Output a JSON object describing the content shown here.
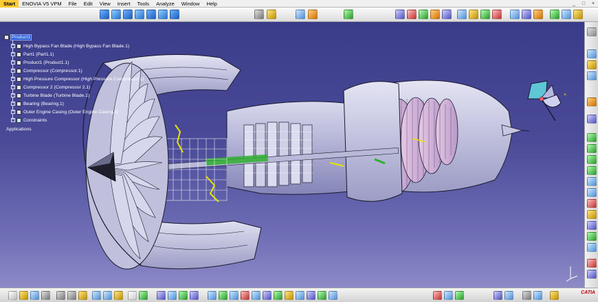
{
  "menu": {
    "items": [
      "Start",
      "ENOVIA V5 VPM",
      "File",
      "Edit",
      "View",
      "Insert",
      "Tools",
      "Analyze",
      "Window",
      "Help"
    ]
  },
  "window_controls": [
    "_",
    "□",
    "×"
  ],
  "tree": {
    "root": "Product1",
    "items": [
      "High Bypass Fan Blade (High Bypass Fan Blade.1)",
      "Part1 (Part1.1)",
      "Product1 (Product1.1)",
      "Compressor (Compressor.1)",
      "High Pressure Compressor (High Pressure Compressor.1)",
      "Compressor 2 (Compressor 2.1)",
      "Turbine Blade (Turbine Blade.1)",
      "Bearing (Bearing.1)",
      "Outer Engine Casing (Outer Engine Casing.1)",
      "Constraints"
    ],
    "footer": "Applications"
  },
  "brand": "CATIA",
  "colors": {
    "background_top": "#3a3c8a",
    "background_bottom": "#8c8ac6",
    "part_fill": "#c9c9e6",
    "part_stroke": "#1a1a2e",
    "selection": "#2c5fd8",
    "highlight_yellow": "#e6e600",
    "highlight_green": "#2fae2f"
  },
  "icons": {
    "top_toolbar": [
      "product-icon",
      "part-icon",
      "assembly-icon",
      "catalog-icon",
      "constraint-icon",
      "measure-icon",
      "analysis-icon",
      "render-icon",
      "light-icon",
      "camera-icon",
      "section-icon",
      "clash-icon",
      "annotation-icon",
      "move-icon",
      "snap-icon"
    ],
    "right_toolbar": [
      "select-icon",
      "component-icon",
      "product-icon",
      "part-icon",
      "replace-icon",
      "graph-icon",
      "renumber-icon",
      "reorder-icon",
      "multi-instance-icon",
      "fast-instance-icon",
      "explode-icon",
      "manipulate-icon",
      "snap-icon",
      "smart-move-icon",
      "coincidence-icon",
      "contact-icon",
      "offset-icon",
      "angle-icon",
      "fix-icon",
      "update-icon",
      "compass-reset-icon"
    ],
    "bottom_toolbar": [
      "new-icon",
      "open-icon",
      "save-icon",
      "print-icon",
      "cut-icon",
      "copy-icon",
      "paste-icon",
      "undo-icon",
      "redo-icon",
      "whats-this-icon",
      "formula-icon",
      "knowledge-icon",
      "macro-icon",
      "fly-icon",
      "fit-all-icon",
      "pan-icon",
      "rotate-icon",
      "zoom-in-icon",
      "zoom-out-icon",
      "normal-view-icon",
      "iso-view-icon",
      "render-style-icon",
      "hide-show-icon",
      "swap-icon",
      "catalog-icon"
    ]
  }
}
